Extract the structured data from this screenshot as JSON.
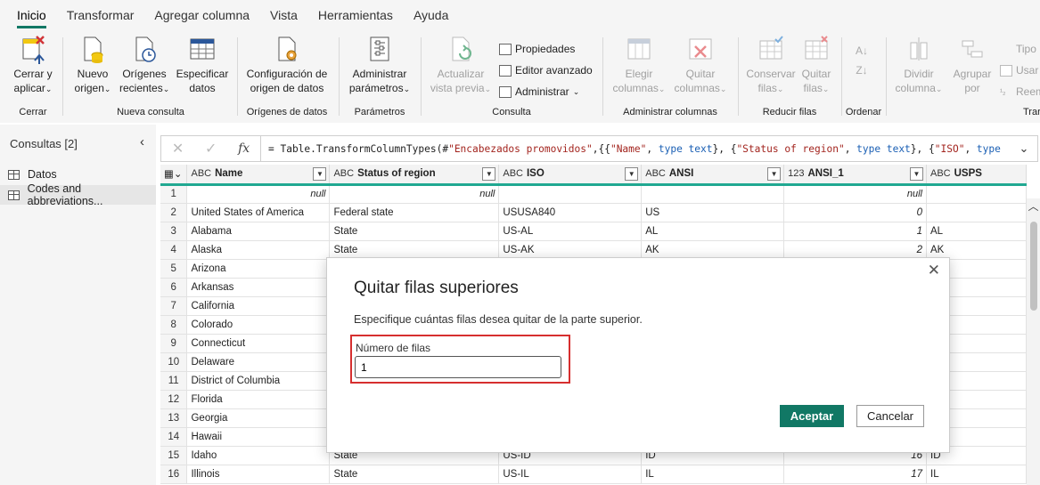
{
  "tabs": [
    "Inicio",
    "Transformar",
    "Agregar columna",
    "Vista",
    "Herramientas",
    "Ayuda"
  ],
  "ribbon": {
    "close": {
      "label1": "Cerrar y",
      "label2": "aplicar",
      "group": "Cerrar"
    },
    "new_source": {
      "label1": "Nuevo",
      "label2": "origen",
      "group": "Nueva consulta"
    },
    "recent": {
      "label1": "Orígenes",
      "label2": "recientes"
    },
    "enter_data": {
      "label1": "Especificar",
      "label2": "datos"
    },
    "ds_settings": {
      "label1": "Configuración de",
      "label2": "origen de datos",
      "group": "Orígenes de datos"
    },
    "params": {
      "label1": "Administrar",
      "label2": "parámetros",
      "group": "Parámetros"
    },
    "refresh": {
      "label1": "Actualizar",
      "label2": "vista previa",
      "group": "Consulta"
    },
    "properties": "Propiedades",
    "adv_editor": "Editor avanzado",
    "manage": "Administrar",
    "choose_cols": {
      "label1": "Elegir",
      "label2": "columnas",
      "group": "Administrar columnas"
    },
    "remove_cols": {
      "label1": "Quitar",
      "label2": "columnas"
    },
    "keep_rows": {
      "label1": "Conservar",
      "label2": "filas",
      "group": "Reducir filas"
    },
    "remove_rows": {
      "label1": "Quitar",
      "label2": "filas"
    },
    "sort_group": "Ordenar",
    "split": {
      "label1": "Dividir",
      "label2": "columna"
    },
    "group_by": {
      "label1": "Agrupar",
      "label2": "por"
    },
    "type_small": "Tipo",
    "use_small": "Usar",
    "replace_small": "Reem",
    "transform_group": "Trar"
  },
  "left": {
    "header": "Consultas [2]",
    "items": [
      "Datos",
      "Codes and abbreviations..."
    ]
  },
  "formula": {
    "p1": "= Table.TransformColumnTypes(#",
    "p2": "\"Encabezados promovidos\"",
    "p3": ",{{",
    "p4": "\"Name\"",
    "p5": ", ",
    "p6": "type text",
    "p7": "}, {",
    "p8": "\"Status of region\"",
    "p9": ", ",
    "p10": "type text",
    "p11": "}, {",
    "p12": "\"ISO\"",
    "p13": ", ",
    "p14": "type"
  },
  "grid": {
    "columns": [
      {
        "type": "ABC",
        "name": "Name"
      },
      {
        "type": "ABC",
        "name": "Status of region"
      },
      {
        "type": "ABC",
        "name": "ISO"
      },
      {
        "type": "ABC",
        "name": "ANSI"
      },
      {
        "type": "123",
        "name": "ANSI_1"
      },
      {
        "type": "ABC",
        "name": "USPS"
      }
    ],
    "rows": [
      [
        "1",
        "null",
        "null",
        "",
        "",
        "null",
        ""
      ],
      [
        "2",
        "United States of America",
        "Federal state",
        "USUSA840",
        "US",
        "0",
        ""
      ],
      [
        "3",
        "Alabama",
        "State",
        "US-AL",
        "AL",
        "1",
        "AL"
      ],
      [
        "4",
        "Alaska",
        "State",
        "US-AK",
        "AK",
        "2",
        "AK"
      ],
      [
        "5",
        "Arizona",
        "",
        "",
        "",
        "",
        ""
      ],
      [
        "6",
        "Arkansas",
        "",
        "",
        "",
        "",
        ""
      ],
      [
        "7",
        "California",
        "",
        "",
        "",
        "",
        ""
      ],
      [
        "8",
        "Colorado",
        "",
        "",
        "",
        "",
        ""
      ],
      [
        "9",
        "Connecticut",
        "",
        "",
        "",
        "",
        ""
      ],
      [
        "10",
        "Delaware",
        "",
        "",
        "",
        "",
        ""
      ],
      [
        "11",
        "District of Columbia",
        "",
        "",
        "",
        "",
        ""
      ],
      [
        "12",
        "Florida",
        "",
        "",
        "",
        "",
        ""
      ],
      [
        "13",
        "Georgia",
        "",
        "",
        "",
        "",
        ""
      ],
      [
        "14",
        "Hawaii",
        "",
        "",
        "",
        "",
        ""
      ],
      [
        "15",
        "Idaho",
        "State",
        "US-ID",
        "ID",
        "16",
        "ID"
      ],
      [
        "16",
        "Illinois",
        "State",
        "US-IL",
        "IL",
        "17",
        "IL"
      ]
    ]
  },
  "dialog": {
    "title": "Quitar filas superiores",
    "description": "Especifique cuántas filas desea quitar de la parte superior.",
    "field_label": "Número de filas",
    "field_value": "1",
    "ok": "Aceptar",
    "cancel": "Cancelar"
  },
  "colors": {
    "accent": "#117865",
    "column_bar": "#21a891",
    "highlight": "#d62f2f"
  }
}
